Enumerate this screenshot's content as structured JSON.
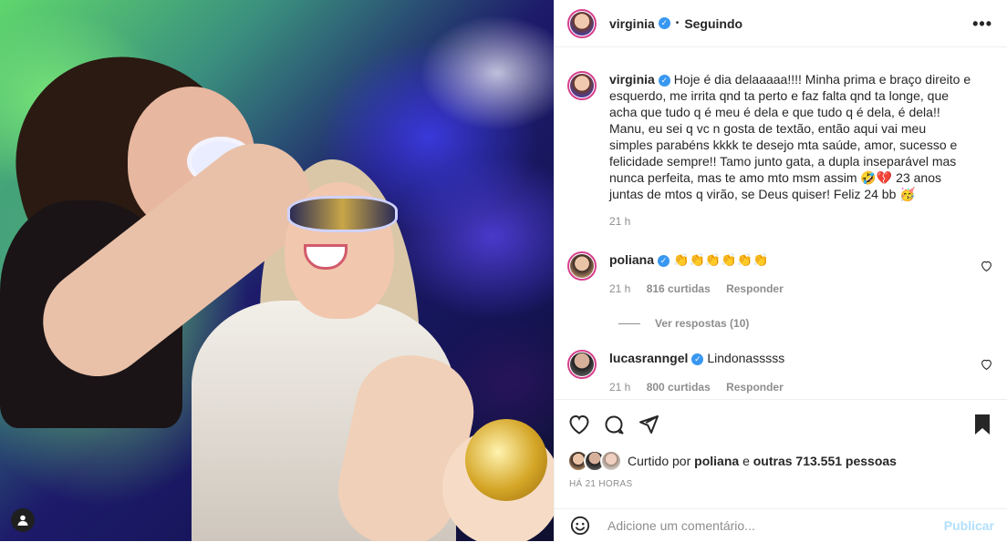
{
  "post": {
    "author": "virginia",
    "follow_status": "Seguindo",
    "more_label": "•••",
    "caption": "Hoje é dia delaaaaa!!!! Minha prima e braço direito e esquerdo, me irrita qnd ta perto e faz falta qnd ta longe, que acha que tudo q é meu é dela e que tudo q é dela, é dela!! Manu, eu sei q vc n gosta de textão, então aqui vai meu simples parabéns kkkk te desejo mta saúde, amor, sucesso e felicidade sempre!! Tamo junto gata, a dupla inseparável mas nunca perfeita, mas te amo mto msm assim 🤣💔 23 anos juntas de mtos q virão, se Deus quiser! Feliz 24 bb 🥳",
    "caption_time": "21 h"
  },
  "comments": [
    {
      "user": "poliana",
      "text": "👏👏👏👏👏👏",
      "time": "21 h",
      "likes": "816 curtidas",
      "reply_label": "Responder",
      "view_replies": "Ver respostas (10)"
    },
    {
      "user": "lucasranngel",
      "text": "Lindonasssss",
      "time": "21 h",
      "likes": "800 curtidas",
      "reply_label": "Responder"
    }
  ],
  "likes": {
    "prefix": "Curtido por",
    "by": "poliana",
    "joiner": "e",
    "others": "outras 713.551 pessoas"
  },
  "time_ago": "HÁ 21 HORAS",
  "add_comment": {
    "placeholder": "Adicione um comentário...",
    "publish_label": "Publicar"
  },
  "icons": {
    "verified": "verified-badge-icon",
    "heart": "heart-icon",
    "comment": "comment-icon",
    "share": "share-icon",
    "save": "bookmark-icon",
    "emoji": "emoji-icon",
    "user_tag": "user-tag-icon",
    "more": "more-options-icon"
  },
  "colors": {
    "verified": "#3897f0",
    "story_ring": "#d63f8c",
    "publish_disabled": "#b2dffc",
    "muted": "#8e8e8e"
  }
}
